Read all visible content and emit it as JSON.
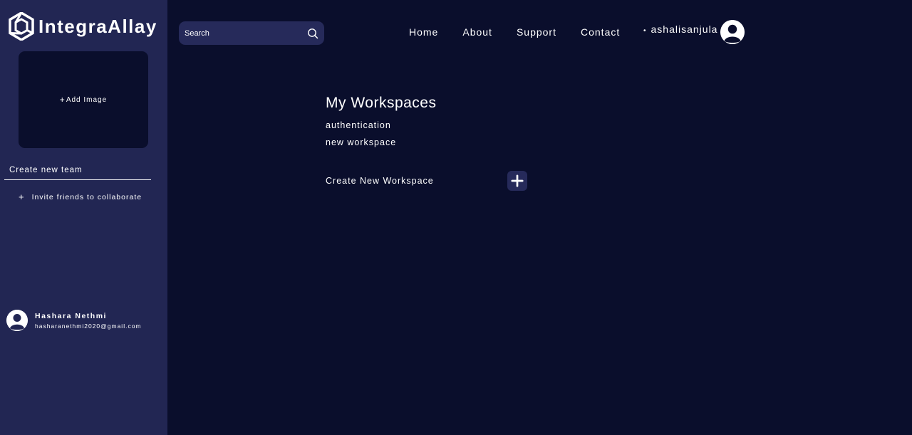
{
  "app": {
    "name": "IntegraAllay"
  },
  "sidebar": {
    "add_image_label": "Add Image",
    "create_team_label": "Create new team",
    "invite_label": "Invite friends to collaborate",
    "user": {
      "name": "Hashara Nethmi",
      "email": "hasharanethmi2020@gmail.com"
    }
  },
  "header": {
    "search": {
      "placeholder": "Search"
    },
    "nav": [
      "Home",
      "About",
      "Support",
      "Contact"
    ],
    "account": {
      "username": "ashalisanjula"
    }
  },
  "main": {
    "title": "My Workspaces",
    "workspaces": [
      "authentication",
      "new workspace"
    ],
    "create_label": "Create New Workspace"
  },
  "colors": {
    "background": "#0a0e2c",
    "sidebar": "#222653",
    "button": "#262a5a",
    "text": "#ffffff"
  },
  "icons": [
    "logo-icon",
    "plus-icon",
    "search-icon",
    "user-avatar-icon"
  ]
}
